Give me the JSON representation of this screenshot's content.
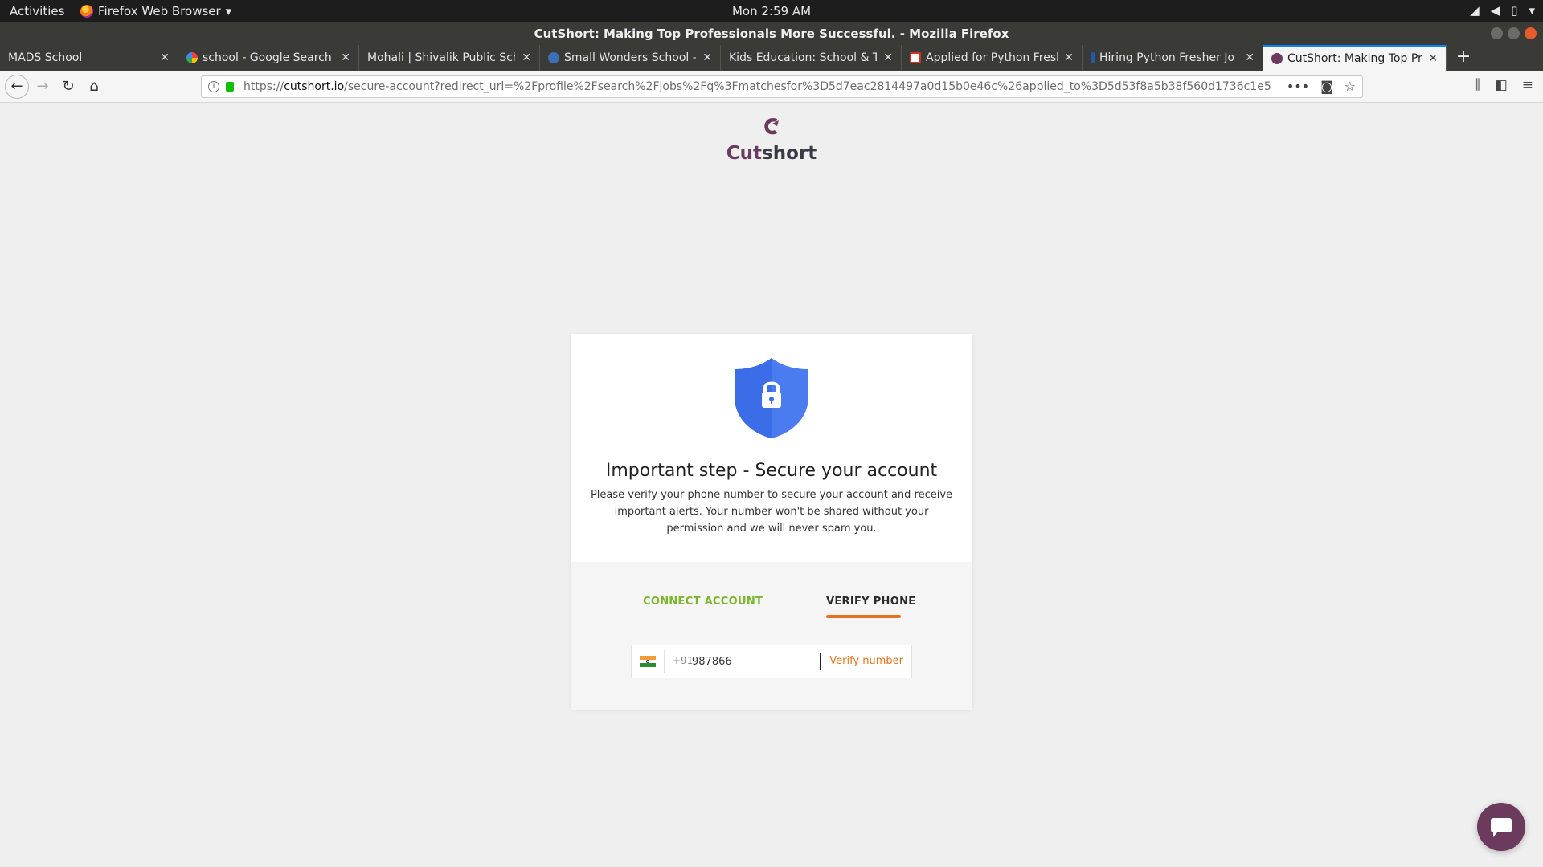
{
  "system": {
    "activities": "Activities",
    "app_menu": "Firefox Web Browser",
    "clock": "Mon  2:59 AM"
  },
  "window": {
    "title": "CutShort: Making Top Professionals More Successful. - Mozilla Firefox"
  },
  "tabs": [
    {
      "title": "MADS School",
      "favicon": "none"
    },
    {
      "title": "school - Google Search",
      "favicon": "google-icon"
    },
    {
      "title": "Mohali | Shivalik Public Scho",
      "favicon": "none"
    },
    {
      "title": "Small Wonders School –",
      "favicon": "school-icon"
    },
    {
      "title": "Kids Education: School & Te",
      "favicon": "none"
    },
    {
      "title": "Applied for Python Fresh",
      "favicon": "gmail-icon"
    },
    {
      "title": "Hiring Python Fresher Jo",
      "favicon": "indeed-icon"
    },
    {
      "title": "CutShort: Making Top Pr",
      "favicon": "cutshort-icon",
      "active": true
    }
  ],
  "url": {
    "prefix": "https://",
    "host": "cutshort.io",
    "path": "/secure-account?redirect_url=%2Fprofile%2Fsearch%2Fjobs%2Fq%3Fmatchesfor%3D5d7eac2814497a0d15b0e46c%26applied_to%3D5d53f8a5b38f560d1736c1e5"
  },
  "brand": {
    "logo_cut": "Cut",
    "logo_short": "short",
    "accent": "#e8731e",
    "purple": "#6b3a5c",
    "green": "#7ab52b"
  },
  "card": {
    "title": "Important step - Secure your account",
    "description": "Please verify your phone number to secure your account and receive important alerts. Your number won't be shared without your permission and we will never spam you.",
    "tabs": {
      "connect": "CONNECT ACCOUNT",
      "verify": "VERIFY PHONE",
      "active": "verify"
    },
    "phone": {
      "country_code": "+91",
      "value": "987866",
      "verify_label": "Verify number"
    }
  }
}
